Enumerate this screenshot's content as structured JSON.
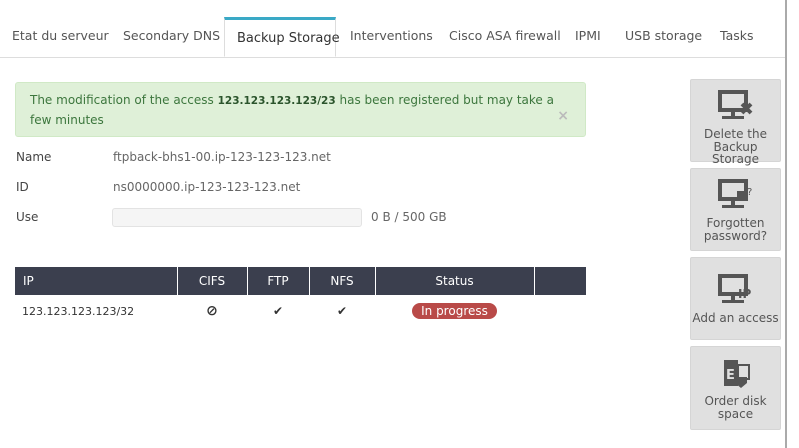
{
  "tabs": [
    {
      "label": "Etat du serveur"
    },
    {
      "label": "Secondary DNS"
    },
    {
      "label": "Backup Storage",
      "active": true
    },
    {
      "label": "Interventions"
    },
    {
      "label": "Cisco ASA firewall"
    },
    {
      "label": "IPMI"
    },
    {
      "label": "USB storage"
    },
    {
      "label": "Tasks"
    }
  ],
  "alert": {
    "prefix": "The modification of the access ",
    "ip": "123.123.123.123/23",
    "suffix": " has been registered but may take a few minutes",
    "close": "×"
  },
  "info": {
    "name_label": "Name",
    "name": "ftpback-bhs1-00.ip-123-123-123.net",
    "id_label": "ID",
    "id": "ns0000000.ip-123-123-123.net",
    "use_label": "Use",
    "use": "0 B / 500 GB",
    "use_fraction": 0
  },
  "table": {
    "headers": [
      "IP",
      "CIFS",
      "FTP",
      "NFS",
      "Status",
      ""
    ],
    "rows": [
      {
        "ip": "123.123.123.123/32",
        "cifs": "⊘",
        "ftp": "✔",
        "nfs": "✔",
        "status": "In progress"
      }
    ]
  },
  "actions": [
    {
      "label": "Delete the Backup Storage",
      "icon": "ftp-delete-icon"
    },
    {
      "label": "Forgotten password?",
      "icon": "ftp-lock-icon"
    },
    {
      "label": "Add an access",
      "icon": "ftp-ip-icon"
    },
    {
      "label": "Order disk space",
      "icon": "exchange-shield-icon"
    }
  ],
  "colors": {
    "accent": "#3aa9c6",
    "header": "#3b3f4e",
    "status": "#b94a48",
    "success_bg": "#dff0d8"
  }
}
